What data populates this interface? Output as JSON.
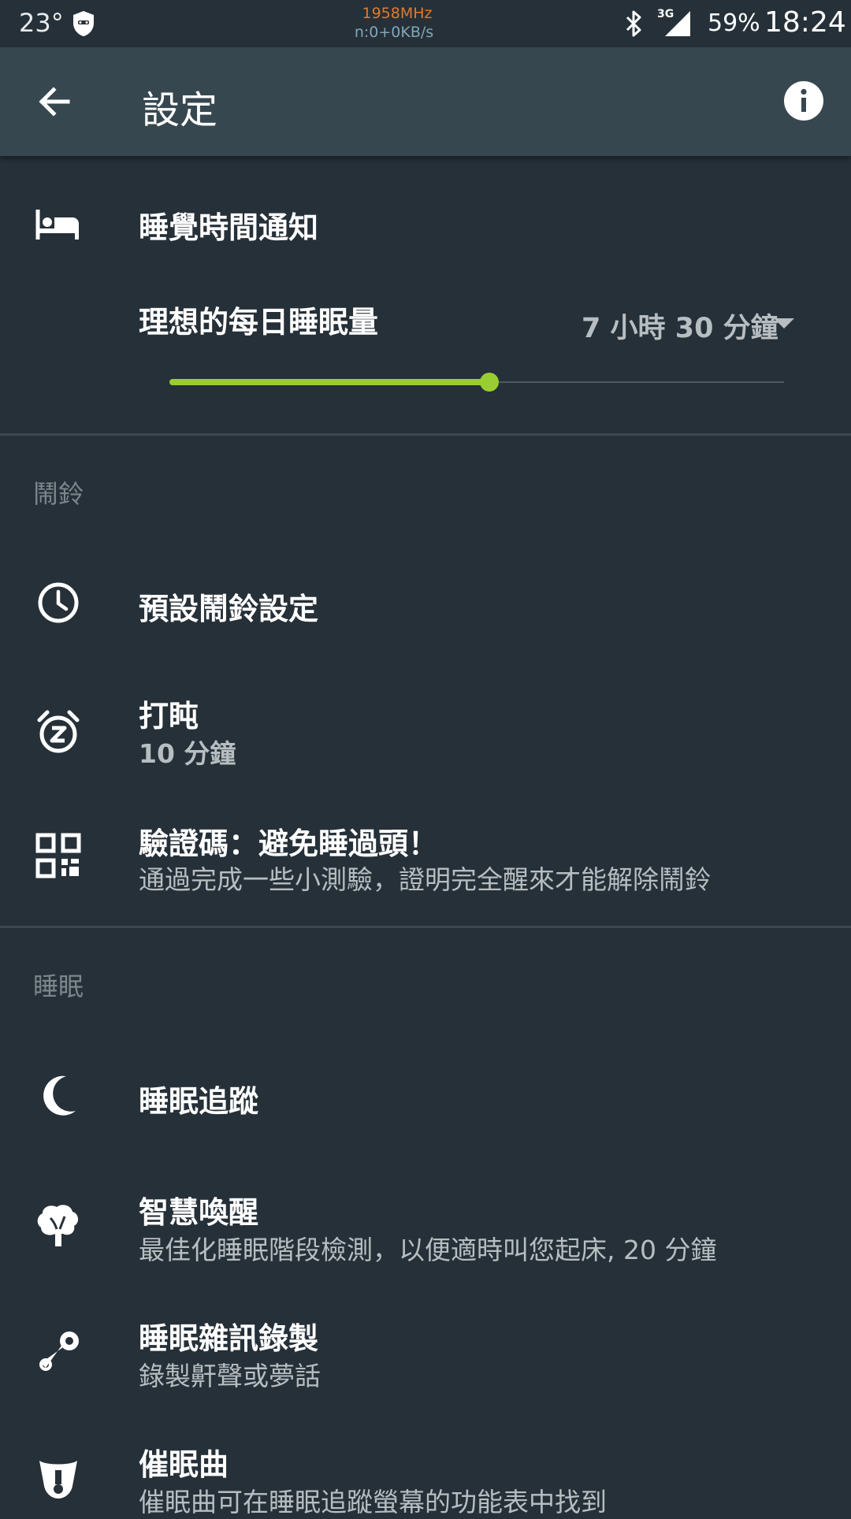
{
  "status_bar": {
    "temperature": "23°",
    "cpu_freq": "1958MHz",
    "net_speed": "n:0+0KB/s",
    "network_type": "3G",
    "battery": "59%",
    "time": "18:24"
  },
  "app_bar": {
    "title": "設定"
  },
  "bedtime": {
    "title": "睡覺時間通知",
    "ideal_sleep_label": "理想的每日睡眠量",
    "ideal_sleep_value": "7 小時 30 分鐘",
    "slider_fraction": 0.52
  },
  "alarm_section": {
    "header": "鬧鈴",
    "items": [
      {
        "title": "預設鬧鈴設定",
        "subtitle": ""
      },
      {
        "title": "打盹",
        "subtitle": "10 分鐘"
      },
      {
        "title": "驗證碼：避免睡過頭！",
        "subtitle": "通過完成一些小測驗，證明完全醒來才能解除鬧鈴"
      }
    ]
  },
  "sleep_section": {
    "header": "睡眠",
    "items": [
      {
        "title": "睡眠追蹤",
        "subtitle": ""
      },
      {
        "title": "智慧喚醒",
        "subtitle": "最佳化睡眠階段檢測，以便適時叫您起床, 20 分鐘"
      },
      {
        "title": "睡眠雜訊錄製",
        "subtitle": "錄製鼾聲或夢話"
      },
      {
        "title": "催眠曲",
        "subtitle": "催眠曲可在睡眠追蹤螢幕的功能表中找到"
      }
    ]
  },
  "colors": {
    "background": "#263038",
    "app_bar": "#37474f",
    "accent": "#9acd32"
  }
}
